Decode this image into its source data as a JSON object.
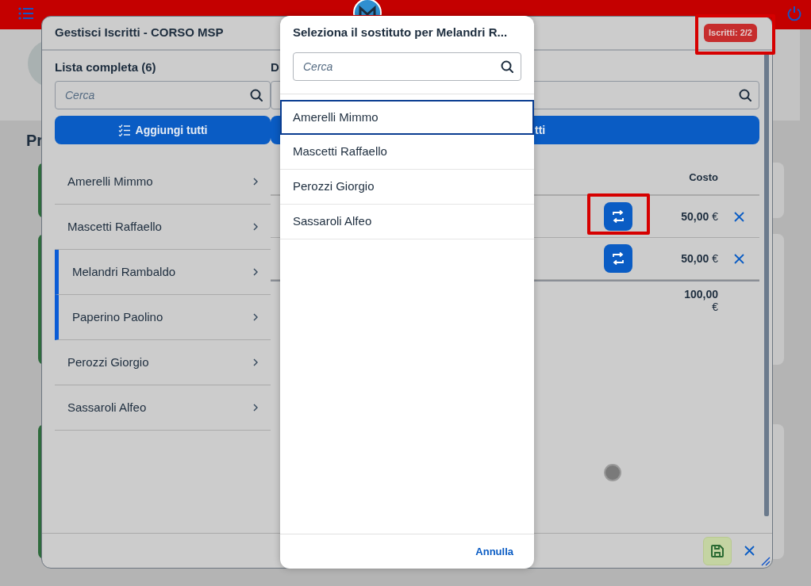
{
  "page": {
    "heading": "Pr"
  },
  "dialog": {
    "title": "Gestisci Iscritti - CORSO MSP",
    "badge": {
      "text": "Iscritti: 2/2",
      "highlighted": true
    },
    "left": {
      "heading": "Lista completa (6)",
      "search": {
        "placeholder": "Cerca"
      },
      "add_all_button": "Aggiungi tutti",
      "items": [
        {
          "name": "Amerelli Mimmo",
          "selected": false
        },
        {
          "name": "Mascetti Raffaello",
          "selected": false
        },
        {
          "name": "Melandri Rambaldo",
          "selected": true
        },
        {
          "name": "Paperino Paolino",
          "selected": true
        },
        {
          "name": "Perozzi Giorgio",
          "selected": false
        },
        {
          "name": "Sassaroli Alfeo",
          "selected": false
        }
      ]
    },
    "right": {
      "heading": "D",
      "add_all_button": "tti",
      "column_header": "Costo",
      "rows": [
        {
          "cost": "50,00",
          "currency": "€",
          "highlighted": true
        },
        {
          "cost": "50,00",
          "currency": "€",
          "highlighted": false
        }
      ],
      "total": {
        "cost": "100,00",
        "currency": "€"
      }
    }
  },
  "picker": {
    "title": "Seleziona il sostituto per Melandri R...",
    "search": {
      "placeholder": "Cerca"
    },
    "items": [
      {
        "name": "Amerelli Mimmo",
        "selected": true
      },
      {
        "name": "Mascetti Raffaello",
        "selected": false
      },
      {
        "name": "Perozzi Giorgio",
        "selected": false
      },
      {
        "name": "Sassaroli Alfeo",
        "selected": false
      }
    ],
    "cancel_button": "Annulla"
  }
}
